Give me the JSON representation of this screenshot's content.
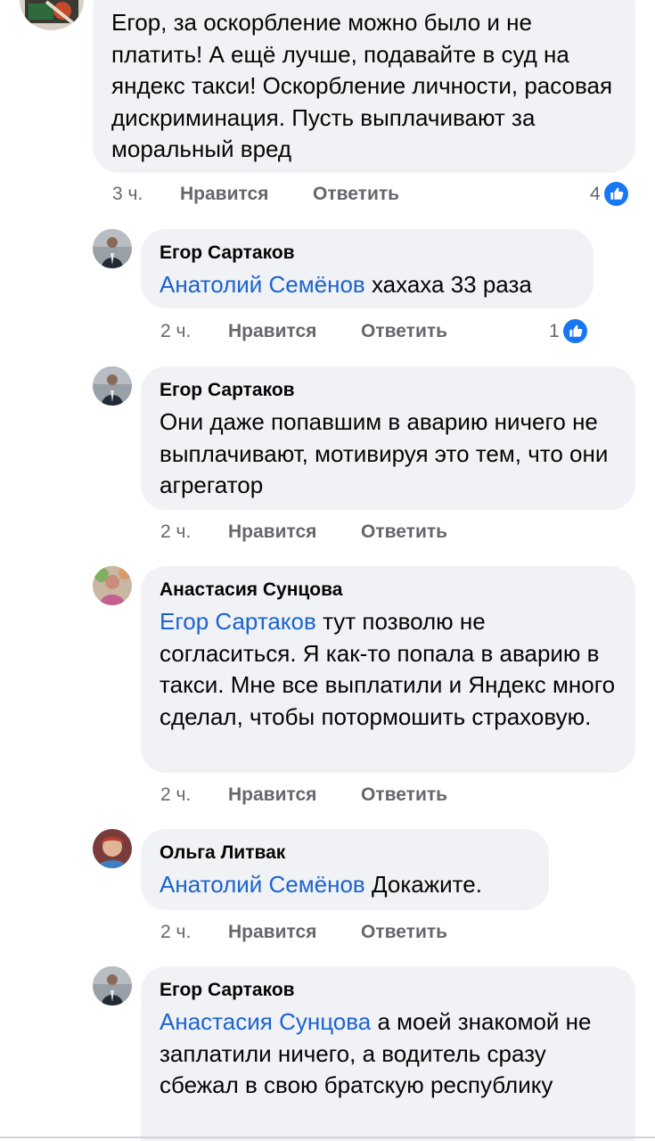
{
  "comments": [
    {
      "author": "",
      "text": "Егор, за оскорбление можно было и не платить! А ещё лучше, подавайте в суд на яндекс такси! Оскорбление личности, расовая дискриминация. Пусть выплачивают за моральный вред",
      "time": "3 ч.",
      "like_label": "Нравится",
      "reply_label": "Ответить",
      "reactions": "4"
    },
    {
      "author": "Егор Сартаков",
      "mention": "Анатолий Семёнов",
      "text": " хахаха 33 раза",
      "time": "2 ч.",
      "like_label": "Нравится",
      "reply_label": "Ответить",
      "reactions": "1"
    },
    {
      "author": "Егор Сартаков",
      "text": "Они даже попавшим в аварию ничего не выплачивают, мотивируя это тем, что они агрегатор",
      "time": "2 ч.",
      "like_label": "Нравится",
      "reply_label": "Ответить"
    },
    {
      "author": "Анастасия Сунцова",
      "mention": "Егор Сартаков",
      "text": " тут позволю не согласиться. Я как-то попала в аварию в такси. Мне все выплатили и Яндекс много сделал, чтобы потормошить страховую.",
      "time": "2 ч.",
      "like_label": "Нравится",
      "reply_label": "Ответить"
    },
    {
      "author": "Ольга Литвак",
      "mention": "Анатолий Семёнов",
      "text": "  Докажите.",
      "time": "2 ч.",
      "like_label": "Нравится",
      "reply_label": "Ответить"
    },
    {
      "author": "Егор Сартаков",
      "mention": "Анастасия Сунцова",
      "text": " а моей знакомой не заплатили ничего, а водитель сразу сбежал в свою братскую республику"
    }
  ],
  "colors": {
    "bubble": "#f0f2f5",
    "mention": "#1b63d1",
    "meta": "#65676b",
    "like_blue": "#1877f2"
  },
  "icons": {
    "reaction": "like-thumb-icon"
  }
}
